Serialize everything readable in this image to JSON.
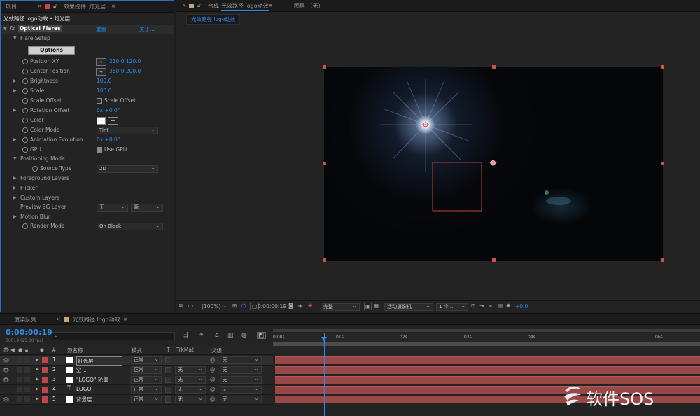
{
  "effect_panel": {
    "tabs": [
      "项目",
      "效果控件",
      "灯光层"
    ],
    "breadcrumb": "光效路径 logo动效 • 灯光层",
    "effect": {
      "fx": "fx",
      "name": "Optical Flares",
      "reset": "重置",
      "about": "关于..."
    },
    "flare_setup": "Flare Setup",
    "options_button": "Options",
    "properties": [
      {
        "label": "Position XY",
        "value": "210.0,120.0"
      },
      {
        "label": "Center Position",
        "value": "350.0,200.0"
      },
      {
        "label": "Brightness",
        "value": "100.0"
      },
      {
        "label": "Scale",
        "value": "100.0"
      },
      {
        "label": "Scale Offset",
        "value": "Scale Offset"
      },
      {
        "label": "Rotation Offset",
        "value": "0x +0.0°"
      },
      {
        "label": "Color",
        "value": ""
      },
      {
        "label": "Color Mode",
        "value": "Tint"
      },
      {
        "label": "Animation Evolution",
        "value": "0x +0.0°"
      },
      {
        "label": "GPU",
        "value": "Use GPU"
      },
      {
        "label": "Positioning Mode",
        "value": ""
      },
      {
        "label": "Source Type",
        "value": "2D"
      },
      {
        "label": "Foreground Layers",
        "value": ""
      },
      {
        "label": "Flicker",
        "value": ""
      },
      {
        "label": "Custom Layers",
        "value": ""
      },
      {
        "label": "Preview BG Layer",
        "value": "无"
      },
      {
        "label": "Motion Blur",
        "value": ""
      },
      {
        "label": "Render Mode",
        "value": "On Black"
      }
    ],
    "preview_bg_source": "源"
  },
  "comp_panel": {
    "tab_label": "合成",
    "comp_name": "光效路径 logo动效",
    "layer_label": "图层 （无）",
    "comp_subtab": "光效路径 logo动效"
  },
  "comp_toolbar": {
    "zoom": "(100%)",
    "timecode": "0:00:00:19",
    "resolution": "完整",
    "camera": "活动摄像机",
    "views": "1 个...",
    "exposure": "+0.0"
  },
  "timeline": {
    "tabs": [
      "渲染队列",
      "光效路径 logo动效"
    ],
    "timecode": "0:00:00:19",
    "frame_info": "00019 (25.00 fps)",
    "search_placeholder": "",
    "columns": {
      "num": "#",
      "source": "源名称",
      "mode": "模式",
      "t": "T",
      "trkmat": "TrkMat",
      "parent": "父级"
    },
    "ruler": [
      "0:00s",
      "01s",
      "02s",
      "03s",
      "04s",
      "06s"
    ],
    "layers": [
      {
        "num": "1",
        "name": "灯光层",
        "mode": "正常",
        "trkmat": "",
        "parent": "无",
        "icon": "solid"
      },
      {
        "num": "2",
        "name": "空 1",
        "mode": "正常",
        "trkmat": "无",
        "parent": "无",
        "icon": "solid"
      },
      {
        "num": "3",
        "name": "\"LOGO\" 轮廓",
        "mode": "正常",
        "trkmat": "无",
        "parent": "无",
        "icon": "solid"
      },
      {
        "num": "4",
        "name": "LOGO",
        "mode": "正常",
        "trkmat": "无",
        "parent": "无",
        "icon": "text"
      },
      {
        "num": "5",
        "name": "背景层",
        "mode": "正常",
        "trkmat": "无",
        "parent": "无",
        "icon": "solid"
      }
    ],
    "label_color": "#c0464a",
    "accent": "#2d8ceb"
  },
  "watermark": "软件SOS"
}
